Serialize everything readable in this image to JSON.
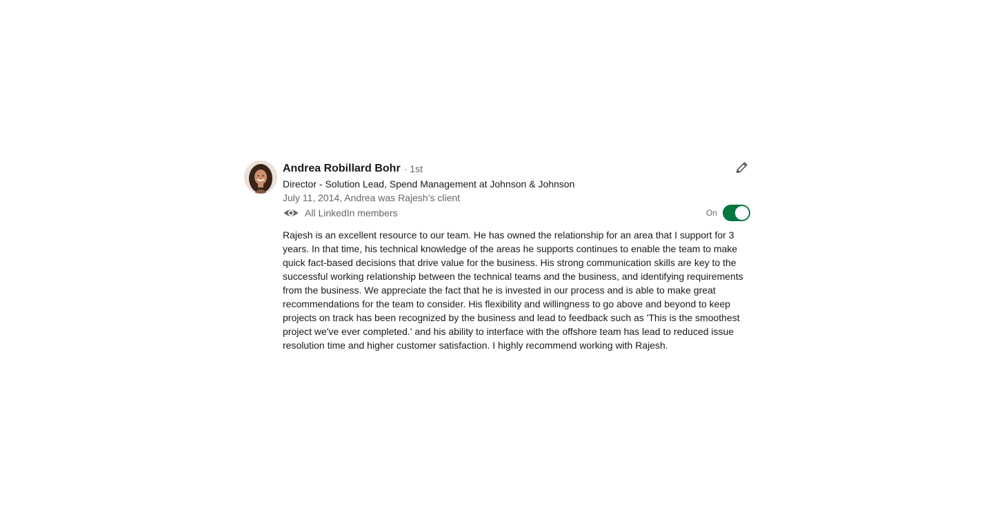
{
  "recommendation": {
    "name": "Andrea Robillard Bohr",
    "degree": "· 1st",
    "headline": "Director - Solution Lead, Spend Management at Johnson & Johnson",
    "relationship": "July 11, 2014, Andrea was Rajesh’s client",
    "visibility_label": "All LinkedIn members",
    "toggle_label": "On",
    "toggle_state": true,
    "body": "Rajesh is an excellent resource to our team. He has owned the relationship for an area that I support for 3 years. In that time, his technical knowledge of the areas he supports continues to enable the team to make quick fact-based decisions that drive value for the business. His strong communication skills are key to the successful working relationship between the technical teams and the business, and identifying requirements from the business. We appreciate the fact that he is invested in our process and is able to make great recommendations for the team to consider. His flexibility and willingness to go above and beyond to keep projects on track has been recognized by the business and lead to feedback such as 'This is the smoothest project we've ever completed.' and his ability to interface with the offshore team has lead to reduced issue resolution time and higher customer satisfaction. I highly recommend working with Rajesh."
  },
  "icons": {
    "edit": "pencil-icon",
    "visibility": "eye-icon"
  },
  "colors": {
    "toggle_on": "#057642",
    "secondary_text": "#666666",
    "primary_text": "#191919"
  }
}
